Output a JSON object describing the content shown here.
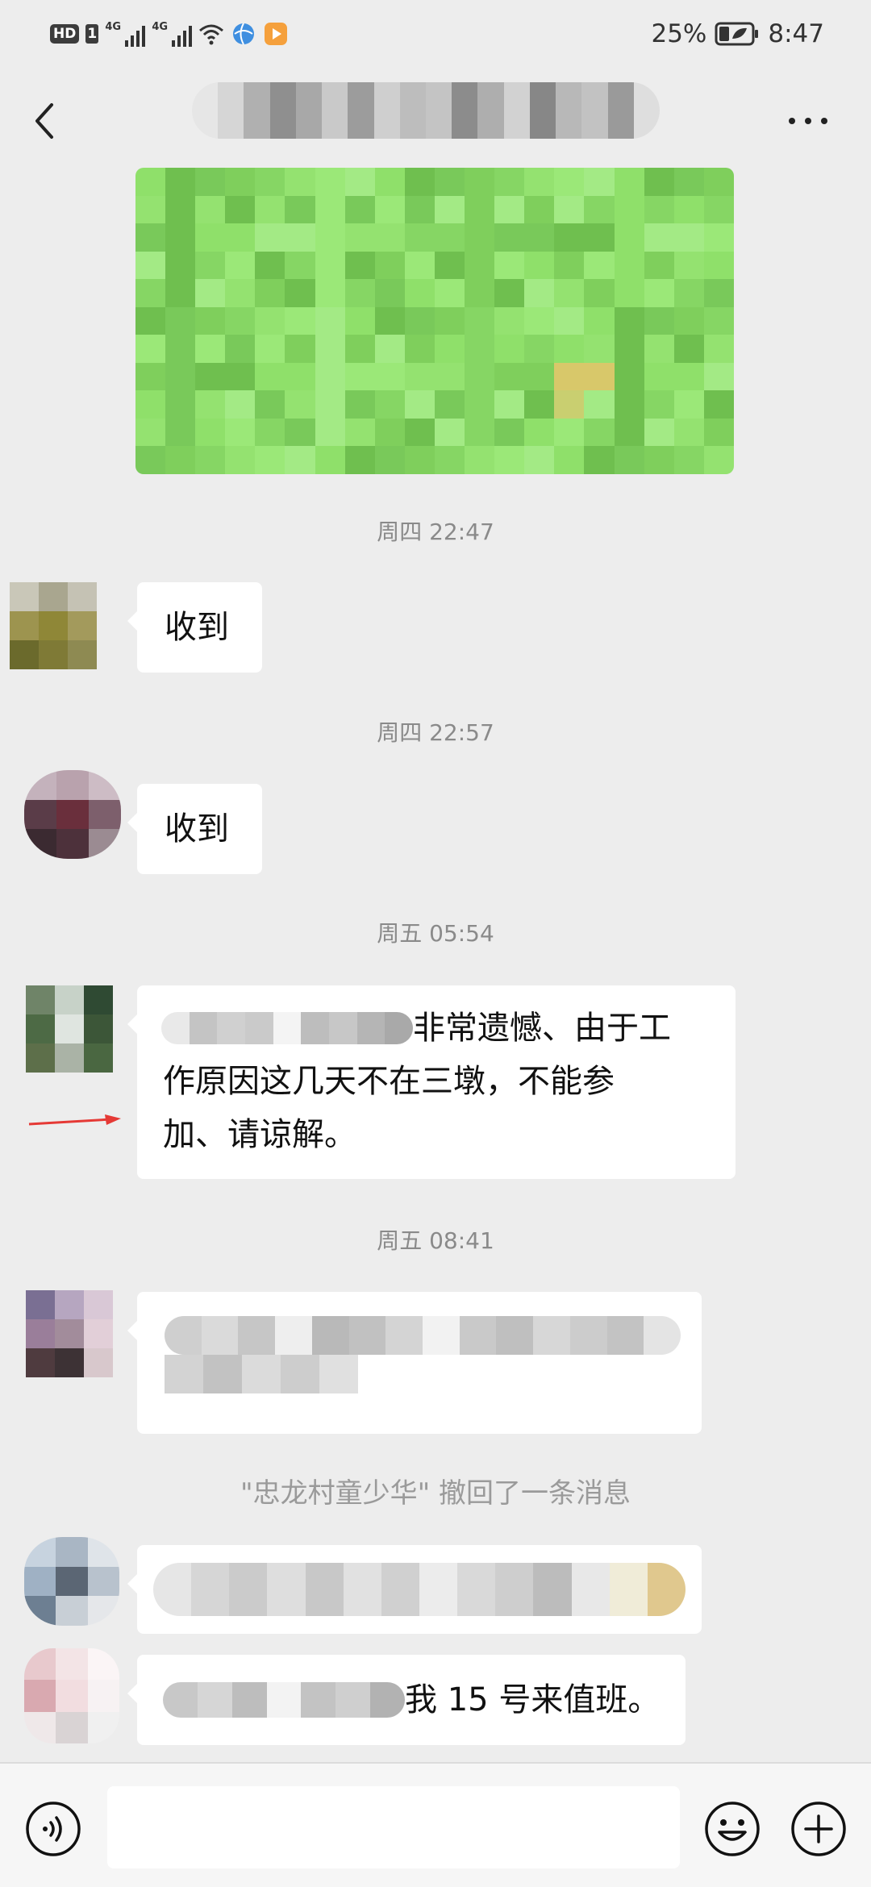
{
  "status_bar": {
    "hd_label": "HD",
    "sim_label": "1",
    "network_1": "4G",
    "network_2": "4G",
    "battery_percent": "25%",
    "time": "8:47",
    "icons": [
      "wifi-icon",
      "browser-icon",
      "video-app-icon",
      "battery-icon"
    ]
  },
  "nav": {
    "back_icon": "chevron-left-icon",
    "more_icon": "more-dots-icon"
  },
  "chat": {
    "timestamps": [
      "周四 22:47",
      "周四 22:57",
      "周五 05:54",
      "周五 08:41"
    ],
    "messages": [
      {
        "text": "收到"
      },
      {
        "text": "收到"
      },
      {
        "text_tail": "非常遗憾、由于工",
        "line2": "作原因这几天不在三墩，不能参",
        "line3": "加、请谅解。"
      },
      {
        "text_tail": "我 15 号来值班。"
      }
    ],
    "recall_notice": "\"忠龙村童少华\" 撤回了一条消息"
  },
  "input": {
    "icons": [
      "voice-icon",
      "emoji-icon",
      "plus-icon"
    ]
  },
  "colors": {
    "background": "#ededed",
    "bubble_self": "#95ec69",
    "bubble_other": "#ffffff",
    "timestamp": "#8a8a8a",
    "annotation_arrow": "#e53935"
  }
}
